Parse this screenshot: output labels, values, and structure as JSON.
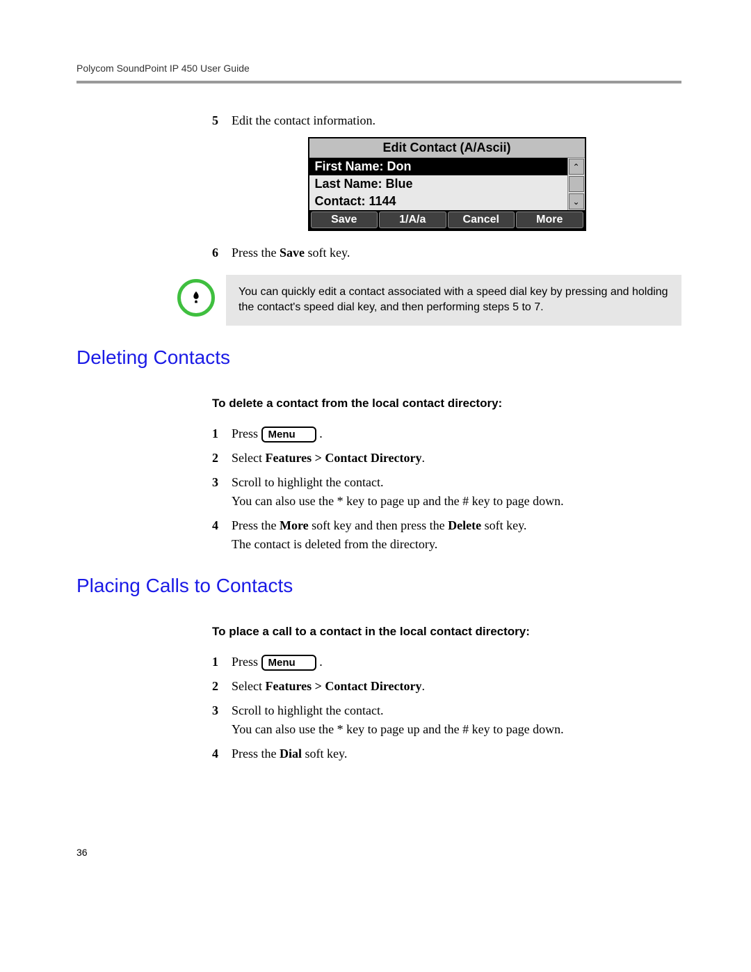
{
  "header": "Polycom SoundPoint IP 450 User Guide",
  "step5": {
    "num": "5",
    "text": "Edit the contact information."
  },
  "phone": {
    "title": "Edit Contact (A/Ascii)",
    "row1": "First Name: Don",
    "row2": "Last Name: Blue",
    "row3": "Contact: 1144",
    "sk1": "Save",
    "sk2": "1/A/a",
    "sk3": "Cancel",
    "sk4": "More"
  },
  "step6": {
    "num": "6",
    "t1": "Press the ",
    "bold": "Save",
    "t2": " soft key."
  },
  "tip": "You can quickly edit a contact associated with a speed dial key by pressing and holding the contact's speed dial key, and then performing steps 5 to 7.",
  "sec1": {
    "heading": "Deleting Contacts",
    "sub": "To delete a contact from the local contact directory:",
    "s1n": "1",
    "s1a": "Press ",
    "s1b": " .",
    "s2n": "2",
    "s2a": "Select ",
    "s2b": "Features > Contact Directory",
    "s2c": ".",
    "s3n": "3",
    "s3a": "Scroll to highlight the contact.",
    "s3b": "You can also use the * key to page up and the # key to page down.",
    "s4n": "4",
    "s4a": "Press the ",
    "s4b1": "More",
    "s4c": " soft key and then press the ",
    "s4b2": "Delete",
    "s4d": " soft key.",
    "s4e": "The contact is deleted from the directory."
  },
  "sec2": {
    "heading": "Placing Calls to Contacts",
    "sub": "To place a call to a contact in the local contact directory:",
    "s1n": "1",
    "s1a": "Press ",
    "s1b": " .",
    "s2n": "2",
    "s2a": "Select ",
    "s2b": "Features > Contact Directory",
    "s2c": ".",
    "s3n": "3",
    "s3a": "Scroll to highlight the contact.",
    "s3b": "You can also use the * key to page up and the # key to page down.",
    "s4n": "4",
    "s4a": "Press the ",
    "s4b": "Dial",
    "s4c": " soft key."
  },
  "menuLabel": "Menu",
  "pageNum": "36"
}
